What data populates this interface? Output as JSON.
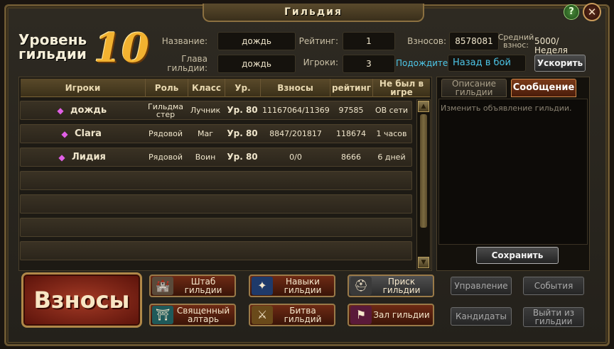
{
  "window": {
    "title": "Гильдия",
    "help": "?",
    "close": "✕"
  },
  "header": {
    "level_line1": "Уровень",
    "level_line2": "гильдии",
    "level_value": "10",
    "name_label": "Название:",
    "name_value": "дождь",
    "leader_label_1": "Глава",
    "leader_label_2": "гильдии:",
    "leader_value": "дождь",
    "rating_label": "Рейтинг:",
    "rating_value": "1",
    "players_label": "Игроки:",
    "players_value": "3",
    "contrib_label": "Взносов:",
    "contrib_value": "8578081",
    "avg_label_1": "Средний",
    "avg_label_2": "взнос:",
    "avg_value": "5000/Неделя",
    "wait_label": "Подождите:",
    "wait_value": "Назад в бой",
    "speedup_button": "Ускорить"
  },
  "table": {
    "headers": [
      "Игроки",
      "Роль",
      "Класс",
      "Ур.",
      "Взносы",
      "рейтинг",
      "Не был в игре"
    ],
    "rows": [
      {
        "name": "дождь",
        "role": "Гильдма стер",
        "class": "Лучник",
        "level": "Ур. 80",
        "contrib": "11167064/11369",
        "rating": "97585",
        "offline": "ОВ сети"
      },
      {
        "name": "Clara",
        "role": "Рядовой",
        "class": "Маг",
        "level": "Ур. 80",
        "contrib": "8847/201817",
        "rating": "118674",
        "offline": "1 часов"
      },
      {
        "name": "Лидия",
        "role": "Рядовой",
        "class": "Воин",
        "level": "Ур. 80",
        "contrib": "0/0",
        "rating": "8666",
        "offline": "6 дней"
      }
    ]
  },
  "right_panel": {
    "tab_description": "Описание гильдии",
    "tab_message": "Сообщение",
    "message_text": "Изменить объявление гильдии.",
    "save_button": "Сохранить"
  },
  "bottom": {
    "contrib_button": "Взносы",
    "nav": [
      {
        "label": "Штаб гильдии",
        "icon": "castle-icon"
      },
      {
        "label": "Навыки гильдии",
        "icon": "magic-orb-icon"
      },
      {
        "label": "Приск гильдии",
        "icon": "knight-helmet-icon"
      },
      {
        "label": "Священный алтарь",
        "icon": "altar-icon"
      },
      {
        "label": "Битва гильдий",
        "icon": "shield-emblem-icon"
      },
      {
        "label": "Зал гильдии",
        "icon": "banner-icon"
      }
    ],
    "side": {
      "manage": "Управление",
      "events": "События",
      "candidates": "Кандидаты",
      "leave": "Выйти из гильдии"
    }
  }
}
